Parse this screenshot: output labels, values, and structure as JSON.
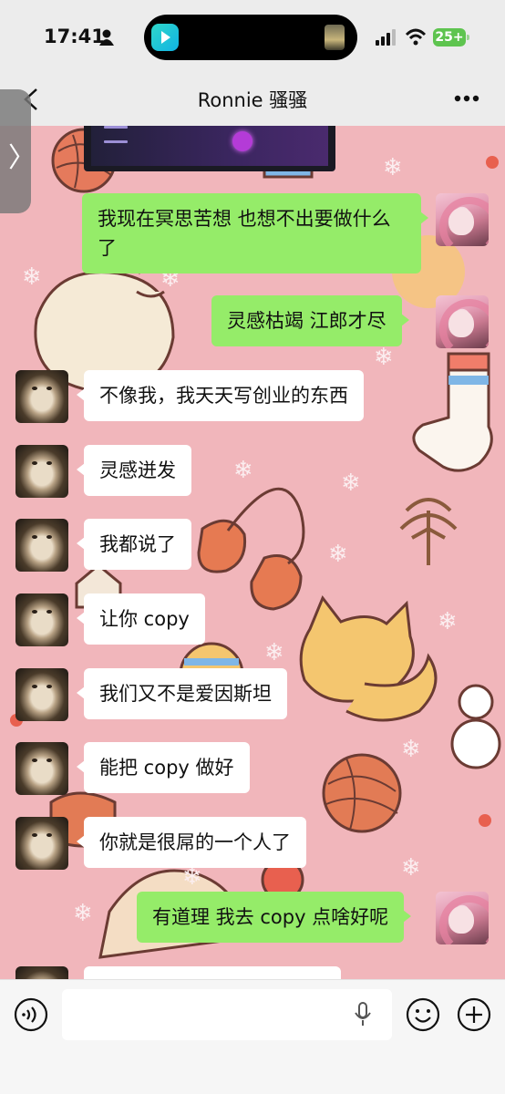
{
  "status_bar": {
    "time": "17:41",
    "battery": "25+"
  },
  "nav": {
    "title": "Ronnie 骚骚"
  },
  "messages": [
    {
      "side": "out",
      "text": "我现在冥思苦想 也想不出要做什么了"
    },
    {
      "side": "out",
      "text": "灵感枯竭 江郎才尽"
    },
    {
      "side": "in",
      "text": "不像我，我天天写创业的东西"
    },
    {
      "side": "in",
      "text": "灵感迸发"
    },
    {
      "side": "in",
      "text": "我都说了"
    },
    {
      "side": "in",
      "text": "让你 copy"
    },
    {
      "side": "in",
      "text": "我们又不是爱因斯坦"
    },
    {
      "side": "in",
      "text": "能把 copy 做好"
    },
    {
      "side": "in",
      "text": "你就是很屌的一个人了"
    },
    {
      "side": "out",
      "text": "有道理 我去 copy 点啥好呢"
    }
  ],
  "input": {
    "value": "",
    "placeholder": ""
  },
  "colors": {
    "out_bubble": "#95ec69",
    "in_bubble": "#ffffff",
    "wallpaper": "#f1b6bb",
    "bar": "#ececec"
  },
  "icons": [
    "person-icon",
    "back-icon",
    "more-icon",
    "voice-icon",
    "mic-icon",
    "emoji-icon",
    "plus-icon",
    "signal-icon",
    "wifi-icon"
  ]
}
